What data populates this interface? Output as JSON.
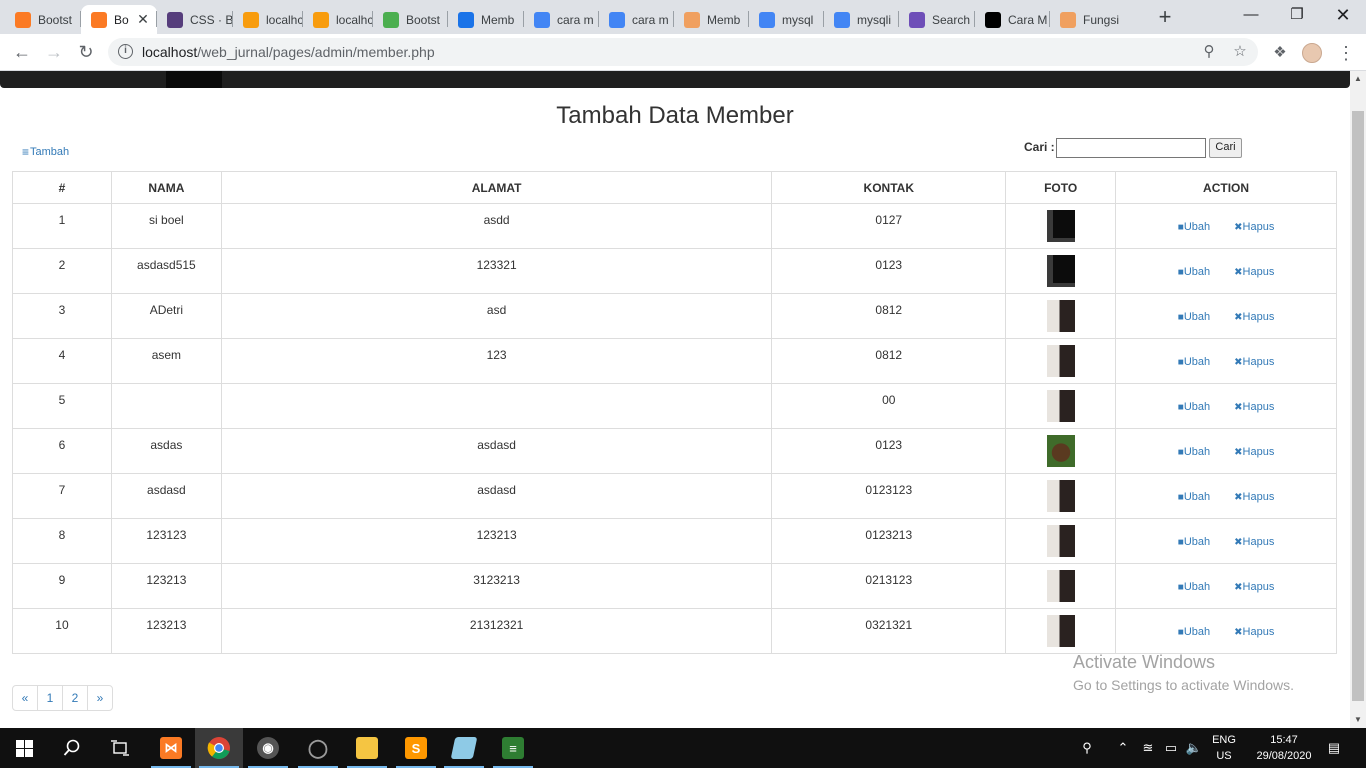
{
  "browser": {
    "tabs": [
      {
        "label": "Bootst",
        "icon": "xampp-icon",
        "color": "#fb7a24"
      },
      {
        "label": "Bo",
        "icon": "xampp-icon",
        "color": "#fb7a24",
        "active": true
      },
      {
        "label": "CSS · B",
        "icon": "bootstrap-icon",
        "color": "#563d7c"
      },
      {
        "label": "localhc",
        "icon": "phpmyadmin-icon",
        "color": "#f89c0e"
      },
      {
        "label": "localhc",
        "icon": "phpmyadmin-icon",
        "color": "#f89c0e"
      },
      {
        "label": "Bootst",
        "icon": "w3schools-icon",
        "color": "#4caf50"
      },
      {
        "label": "Memb",
        "icon": "code-icon",
        "color": "#1a73e8"
      },
      {
        "label": "cara m",
        "icon": "google-icon",
        "color": "#4285f4"
      },
      {
        "label": "cara m",
        "icon": "google-icon",
        "color": "#4285f4"
      },
      {
        "label": "Memb",
        "icon": "page-icon",
        "color": "#f0a060"
      },
      {
        "label": "mysql",
        "icon": "google-icon",
        "color": "#4285f4"
      },
      {
        "label": "mysqli",
        "icon": "google-icon",
        "color": "#4285f4"
      },
      {
        "label": "Search",
        "icon": "search-site-icon",
        "color": "#6e4eb8"
      },
      {
        "label": "Cara M",
        "icon": "medium-icon",
        "color": "#000000"
      },
      {
        "label": "Fungsi",
        "icon": "page-icon",
        "color": "#f0a060"
      }
    ],
    "url_host": "localhost",
    "url_path": "/web_jurnal/pages/admin/member.php"
  },
  "page": {
    "title": "Tambah Data Member",
    "add_label": "Tambah",
    "search": {
      "label": "Cari :",
      "value": "",
      "button": "Cari"
    },
    "columns": [
      "#",
      "NAMA",
      "ALAMAT",
      "KONTAK",
      "FOTO",
      "ACTION"
    ],
    "rows": [
      {
        "no": "1",
        "nama": "si boel",
        "alamat": "asdd",
        "kontak": "0127",
        "foto": "dark"
      },
      {
        "no": "2",
        "nama": "asdasd515",
        "alamat": "123321",
        "kontak": "0123",
        "foto": "dark"
      },
      {
        "no": "3",
        "nama": "ADetri",
        "alamat": "asd",
        "kontak": "0812",
        "foto": "portrait"
      },
      {
        "no": "4",
        "nama": "asem",
        "alamat": "123",
        "kontak": "0812",
        "foto": "portrait"
      },
      {
        "no": "5",
        "nama": "",
        "alamat": "",
        "kontak": "00",
        "foto": "portrait"
      },
      {
        "no": "6",
        "nama": "asdas",
        "alamat": "asdasd",
        "kontak": "0123",
        "foto": "green"
      },
      {
        "no": "7",
        "nama": "asdasd",
        "alamat": "asdasd",
        "kontak": "0123123",
        "foto": "portrait"
      },
      {
        "no": "8",
        "nama": "123123",
        "alamat": "123213",
        "kontak": "0123213",
        "foto": "portrait"
      },
      {
        "no": "9",
        "nama": "123213",
        "alamat": "3123213",
        "kontak": "0213123",
        "foto": "portrait"
      },
      {
        "no": "10",
        "nama": "123213",
        "alamat": "21312321",
        "kontak": "0321321",
        "foto": "portrait"
      }
    ],
    "action_edit": "Ubah",
    "action_delete": "Hapus",
    "pagination": [
      "«",
      "1",
      "2",
      "»"
    ],
    "watermark_title": "Activate Windows",
    "watermark_sub": "Go to Settings to activate Windows."
  },
  "taskbar": {
    "lang_1": "ENG",
    "lang_2": "US",
    "time": "15:47",
    "date": "29/08/2020"
  },
  "colors": {
    "link": "#337ab7",
    "navbar": "#1f1f1f",
    "taskbar": "#101010"
  }
}
